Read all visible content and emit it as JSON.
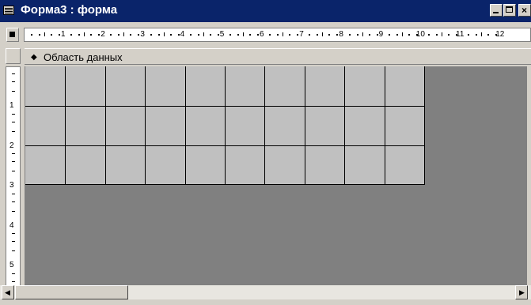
{
  "window": {
    "title": "Форма3 : форма",
    "icon": "form-icon"
  },
  "title_buttons": {
    "minimize": "minimize-icon",
    "maximize": "maximize-icon",
    "close_glyph": "×"
  },
  "section": {
    "label": "Область данных",
    "arrow_glyph": "◆"
  },
  "rulers": {
    "horizontal": [
      "1",
      "2",
      "3",
      "4",
      "5",
      "6",
      "7",
      "8",
      "9",
      "10",
      "11",
      "12"
    ],
    "vertical": [
      "1",
      "2",
      "3",
      "4",
      "5"
    ]
  },
  "scrollbar": {
    "left_glyph": "◀",
    "right_glyph": "▶"
  },
  "grid": {
    "columns": 10,
    "rows": 3
  },
  "colors": {
    "titlebar": "#0a246a",
    "workspace": "#808080",
    "grid": "#c0c0c0",
    "chrome": "#d4d0c8"
  }
}
